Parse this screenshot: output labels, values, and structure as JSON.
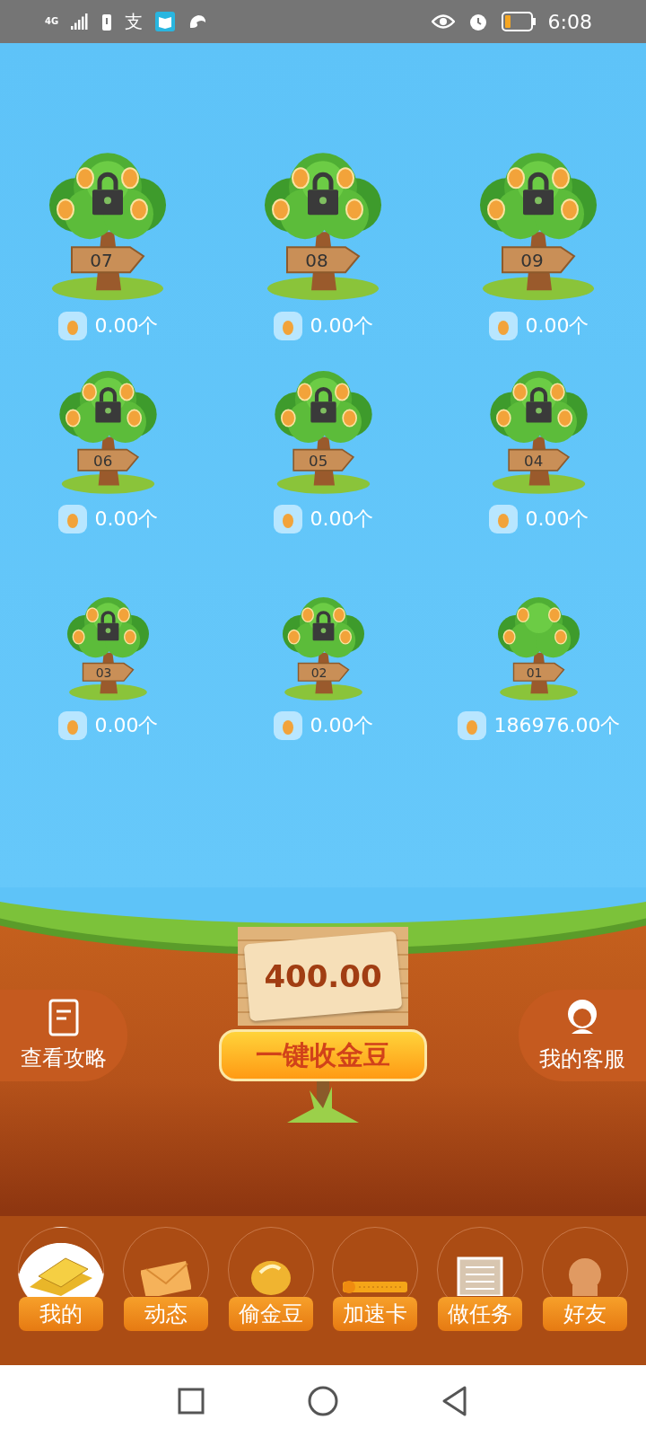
{
  "status_bar": {
    "network": "4G",
    "app_glyph": "支",
    "time": "6:08"
  },
  "tree_rows": [
    [
      {
        "number": "07",
        "amount": "0.00个",
        "locked": true
      },
      {
        "number": "08",
        "amount": "0.00个",
        "locked": true
      },
      {
        "number": "09",
        "amount": "0.00个",
        "locked": true
      }
    ],
    [
      {
        "number": "06",
        "amount": "0.00个",
        "locked": true
      },
      {
        "number": "05",
        "amount": "0.00个",
        "locked": true
      },
      {
        "number": "04",
        "amount": "0.00个",
        "locked": true
      }
    ],
    [
      {
        "number": "03",
        "amount": "0.00个",
        "locked": true
      },
      {
        "number": "02",
        "amount": "0.00个",
        "locked": true
      },
      {
        "number": "01",
        "amount": "186976.00个",
        "locked": false
      }
    ]
  ],
  "board": {
    "value": "400.00",
    "button": "一键收金豆"
  },
  "side_left": {
    "label": "查看攻略"
  },
  "side_right": {
    "label": "我的客服"
  },
  "bottom_nav": [
    {
      "kind": "gold",
      "label": "我的"
    },
    {
      "kind": "mail",
      "label": "动态"
    },
    {
      "kind": "bean",
      "label": "偷金豆"
    },
    {
      "kind": "card",
      "label": "加速卡"
    },
    {
      "kind": "task",
      "label": "做任务"
    },
    {
      "kind": "friend",
      "label": "好友"
    }
  ]
}
